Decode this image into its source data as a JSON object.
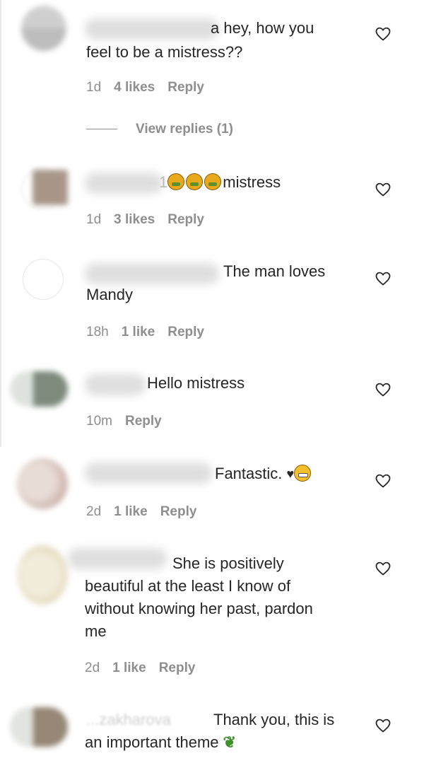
{
  "comments": [
    {
      "text_line1": "a hey, how you",
      "text_line2": "feel to be a mistress??",
      "time": "1d",
      "likes": "4 likes",
      "reply": "Reply",
      "view_replies": "View replies (1)"
    },
    {
      "prefix": "1",
      "text": "mistress",
      "time": "1d",
      "likes": "3 likes",
      "reply": "Reply"
    },
    {
      "text_line1": "The man loves",
      "text_line2": "Mandy",
      "time": "18h",
      "likes": "1 like",
      "reply": "Reply"
    },
    {
      "text": "Hello mistress",
      "time": "10m",
      "reply": "Reply"
    },
    {
      "text": "Fantastic.",
      "time": "2d",
      "likes": "1 like",
      "reply": "Reply"
    },
    {
      "text_line1": "She is positively",
      "text_line2": "beautiful at the least I know of",
      "text_line3": "without knowing her past, pardon",
      "text_line4": "me",
      "time": "2d",
      "likes": "1 like",
      "reply": "Reply"
    },
    {
      "username_partial": "...zakharova",
      "text_line1": "Thank you, this is",
      "text_line2": "an important theme"
    }
  ],
  "icons": {
    "like": "heart-outline-icon",
    "vomit_emoji": "face-vomiting-emoji",
    "grin_emoji": "grimacing-face-emoji",
    "small_heart": "black-heart-icon",
    "leaf_emoji": "herb-emoji"
  },
  "colors": {
    "text": "#262626",
    "meta": "#8e8e8e",
    "background": "#ffffff"
  }
}
